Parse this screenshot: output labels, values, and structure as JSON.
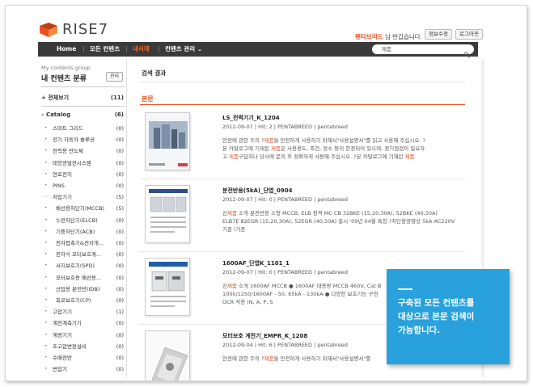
{
  "header": {
    "logo_text": "RISE7",
    "brand_color": "#e8501f",
    "greeting_user": "팬타브리드",
    "greeting_suffix": " 님 반갑습니다.",
    "info_button": "정보수정",
    "logout_button": "로그아웃"
  },
  "nav": {
    "items": [
      {
        "label": "Home"
      },
      {
        "label": "모든 컨텐츠"
      },
      {
        "label": "내서재"
      },
      {
        "label": "컨텐츠 관리 ⌄"
      }
    ],
    "search_value": "제품"
  },
  "sidebar": {
    "subtitle": "My contents group",
    "title": "내 컨텐츠 분류",
    "manage_button": "관리",
    "all": {
      "label": "전체보기",
      "count": "(11)"
    },
    "catalog": {
      "label": "Catalog",
      "count": "(6)"
    },
    "items": [
      {
        "label": "스마트 그리드",
        "count": "(0)"
      },
      {
        "label": "전기 자동차 솔루션",
        "count": "(0)"
      },
      {
        "label": "전력용 반도체",
        "count": "(0)"
      },
      {
        "label": "태양광발전시스템",
        "count": "(0)"
      },
      {
        "label": "연료전지",
        "count": "(0)"
      },
      {
        "label": "PINS",
        "count": "(0)"
      },
      {
        "label": "저압기기",
        "count": "(5)"
      },
      {
        "label": "배선용차단기(MCCB)",
        "count": "(5)"
      },
      {
        "label": "누전차단기(ELCB)",
        "count": "(0)"
      },
      {
        "label": "기중차단기(ACB)",
        "count": "(0)"
      },
      {
        "label": "전자접촉기&전자개...",
        "count": "(0)"
      },
      {
        "label": "전자식 모터보호계...",
        "count": "(0)"
      },
      {
        "label": "서지보호기(SPD)",
        "count": "(0)"
      },
      {
        "label": "모터보호용 배선용...",
        "count": "(0)"
      },
      {
        "label": "산업용 분전반(IDB)",
        "count": "(0)"
      },
      {
        "label": "회로보호기(CP)",
        "count": "(0)"
      },
      {
        "label": "고압기기",
        "count": "(1)"
      },
      {
        "label": "계전계측기기",
        "count": "(0)"
      },
      {
        "label": "계량기기",
        "count": "(0)"
      },
      {
        "label": "초고압변전설비",
        "count": "(0)"
      },
      {
        "label": "수배전반",
        "count": "(0)"
      },
      {
        "label": "변압기",
        "count": "(0)"
      }
    ]
  },
  "main": {
    "breadcrumb": "검색 결과",
    "section_title": "본문",
    "results": [
      {
        "title": "LS_전력기기_K_1204",
        "meta": "2012-09-07  |  Hit: 2  |  PENTABREED  |  pentabreed",
        "snippet_1a": "안전에 관한 주의 ?",
        "snippet_1b": "제품",
        "snippet_1c": "을 안전하게 사용하기 위해서\"사용설명서\"를 읽고 사용해 주십시오. ?",
        "snippet_2a": "본 카탈로그에 기재된 ",
        "snippet_2b": "제품",
        "snippet_2c": "은 사용용도, 조건, 장소 등이 한정되어 있으며, 정기점검이 필요하",
        "snippet_3a": "고 ",
        "snippet_3b": "제품",
        "snippet_3c": "구입처나 당사에 문의 후 정확하게 사용해 주십시오. ?본 카탈로그에 기재된 ",
        "snippet_3d": "제품"
      },
      {
        "title": "분전반용(5kA)_단엽_0904",
        "meta": "2012-09-07  |  Hit: 0  |  PENTABREED  |  pentabreed",
        "snippet_1a": "신",
        "snippet_1b": "제품",
        "snippet_1c": " 소개 분전반용 소형 MCCB, ELB 정격 MC CB 32BKE (15,20,30A), 52BKE (40,50A)",
        "snippet_2a": "ELB7E 82EGR (15,20,30A), 52EGR (40,50A) 출시 '09년 04월 특징 ?차단용량향상 5kA AC220V",
        "snippet_3a": "기준 (기존"
      },
      {
        "title": "1600AF_단엽K_1101_1",
        "meta": "2012-09-07  |  Hit: 0  |  PENTABREED  |  pentabreed",
        "snippet_1a": "신",
        "snippet_1b": "제품",
        "snippet_1c": " 소개 1600AF MCCB ● 1600AF 대용량 MCCB 460V, Cat B",
        "snippet_2a": "1000/1250/1600AF - 50, 65kA - 130kA ● 다양한 보호기능 구현",
        "snippet_3a": "OCR 적용 (N, A, P, S"
      },
      {
        "title": "모터보호 계전기_EMPR_K_1208",
        "meta": "2012-09-04  |  Hit: 6  |  PENTABREED  |  pentabreed",
        "snippet_1a": "안전에 관한 주의 ?",
        "snippet_1b": "제품",
        "snippet_1c": "을 안전하게 사용하기 위해서\"사용설명서\"를"
      }
    ]
  },
  "callout": {
    "line1": "구축된 모든 컨텐츠를",
    "line2": "대상으로 본문 검색이",
    "line3": "가능합니다.",
    "color": "#29a1dc"
  }
}
